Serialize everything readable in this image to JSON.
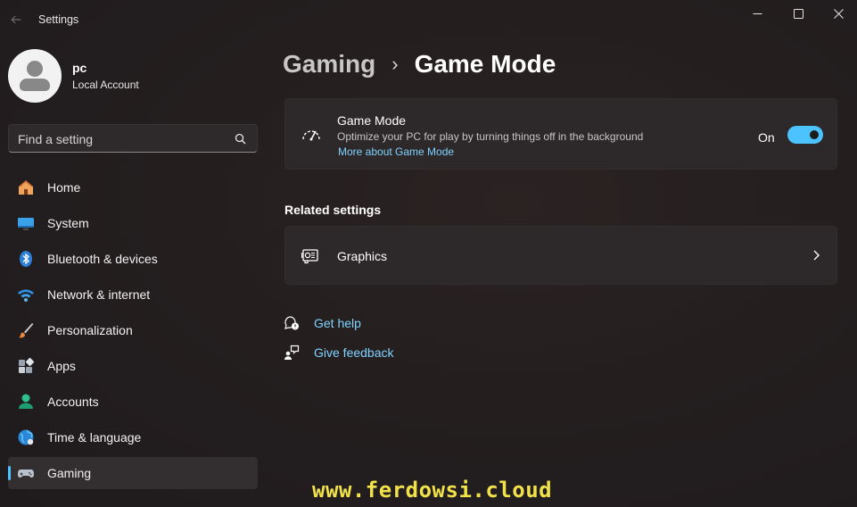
{
  "window": {
    "title": "Settings"
  },
  "profile": {
    "name": "pc",
    "account_type": "Local Account"
  },
  "search": {
    "placeholder": "Find a setting"
  },
  "sidebar": {
    "items": [
      {
        "label": "Home",
        "icon": "home-icon"
      },
      {
        "label": "System",
        "icon": "system-icon"
      },
      {
        "label": "Bluetooth & devices",
        "icon": "bluetooth-icon"
      },
      {
        "label": "Network & internet",
        "icon": "wifi-icon"
      },
      {
        "label": "Personalization",
        "icon": "brush-icon"
      },
      {
        "label": "Apps",
        "icon": "apps-icon"
      },
      {
        "label": "Accounts",
        "icon": "accounts-icon"
      },
      {
        "label": "Time & language",
        "icon": "globe-icon"
      },
      {
        "label": "Gaming",
        "icon": "controller-icon",
        "active": true
      }
    ]
  },
  "breadcrumb": {
    "parent": "Gaming",
    "separator": "›",
    "current": "Game Mode"
  },
  "game_mode_card": {
    "title": "Game Mode",
    "description": "Optimize your PC for play by turning things off in the background",
    "link": "More about Game Mode",
    "toggle_state_label": "On",
    "toggle_on": true
  },
  "related_settings": {
    "title": "Related settings",
    "items": [
      {
        "label": "Graphics",
        "icon": "graphics-card-icon"
      }
    ]
  },
  "help": {
    "get_help": "Get help",
    "give_feedback": "Give feedback"
  },
  "watermark": "www.ferdowsi.cloud",
  "colors": {
    "accent": "#4cc2ff",
    "link": "#7fd3ff",
    "card_bg": "#2d2829",
    "watermark": "#f1e24a"
  }
}
